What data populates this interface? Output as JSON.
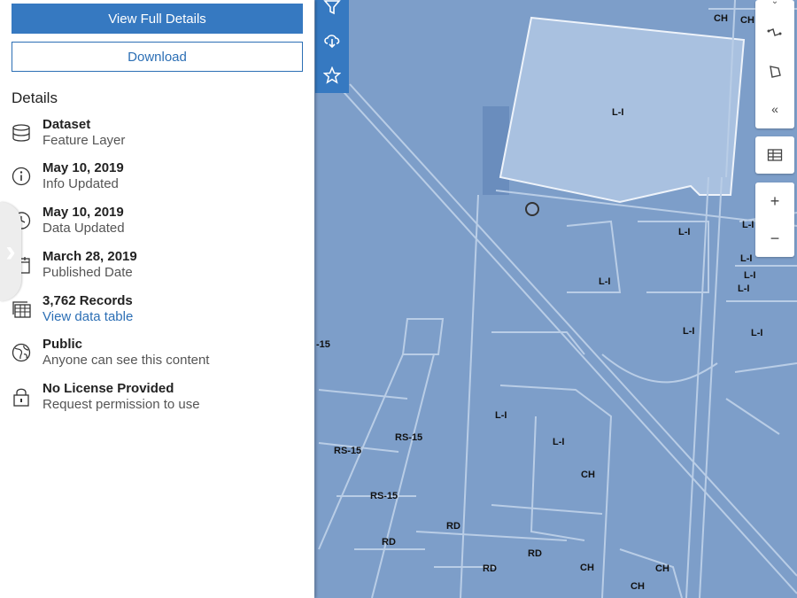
{
  "panel": {
    "view_full_details_label": "View Full Details",
    "download_label": "Download",
    "details_heading": "Details",
    "details": [
      {
        "icon": "database-icon",
        "title": "Dataset",
        "subtitle": "Feature Layer"
      },
      {
        "icon": "info-icon",
        "title": "May 10, 2019",
        "subtitle": "Info Updated"
      },
      {
        "icon": "history-clock-icon",
        "title": "May 10, 2019",
        "subtitle": "Data Updated"
      },
      {
        "icon": "calendar-icon",
        "title": "March 28, 2019",
        "subtitle": "Published Date"
      },
      {
        "icon": "table-stack-icon",
        "title": "3,762 Records",
        "subtitle": "View data table"
      },
      {
        "icon": "globe-icon",
        "title": "Public",
        "subtitle": "Anyone can see this content"
      },
      {
        "icon": "lock-icon",
        "title": "No License Provided",
        "subtitle": "Request permission to use"
      }
    ]
  },
  "map_tools": [
    "filter-icon",
    "cloud-download-icon",
    "star-icon"
  ],
  "right_controls": [
    "draw-line-icon",
    "draw-polygon-icon",
    "collapse-left-icon",
    "table-icon",
    "zoom-in-icon",
    "zoom-out-icon"
  ],
  "colors": {
    "primary": "#3679c1",
    "map_fill": "#7d9ec9",
    "highlight_fill": "#a9c1e0"
  },
  "map_labels": [
    {
      "text": "CH"
    },
    {
      "text": "CH"
    },
    {
      "text": "L-I"
    },
    {
      "text": "L-I"
    },
    {
      "text": "L-I"
    },
    {
      "text": "L-I"
    },
    {
      "text": "L-I"
    },
    {
      "text": "L-I"
    },
    {
      "text": "L-I"
    },
    {
      "text": "L-I"
    },
    {
      "text": "L-I"
    },
    {
      "text": "L-I"
    },
    {
      "text": "L-I"
    },
    {
      "text": "-15"
    },
    {
      "text": "RS-15"
    },
    {
      "text": "RS-15"
    },
    {
      "text": "RS-15"
    },
    {
      "text": "CH"
    },
    {
      "text": "RD"
    },
    {
      "text": "RD"
    },
    {
      "text": "RD"
    },
    {
      "text": "RD"
    },
    {
      "text": "CH"
    },
    {
      "text": "CH"
    },
    {
      "text": "CH"
    }
  ]
}
